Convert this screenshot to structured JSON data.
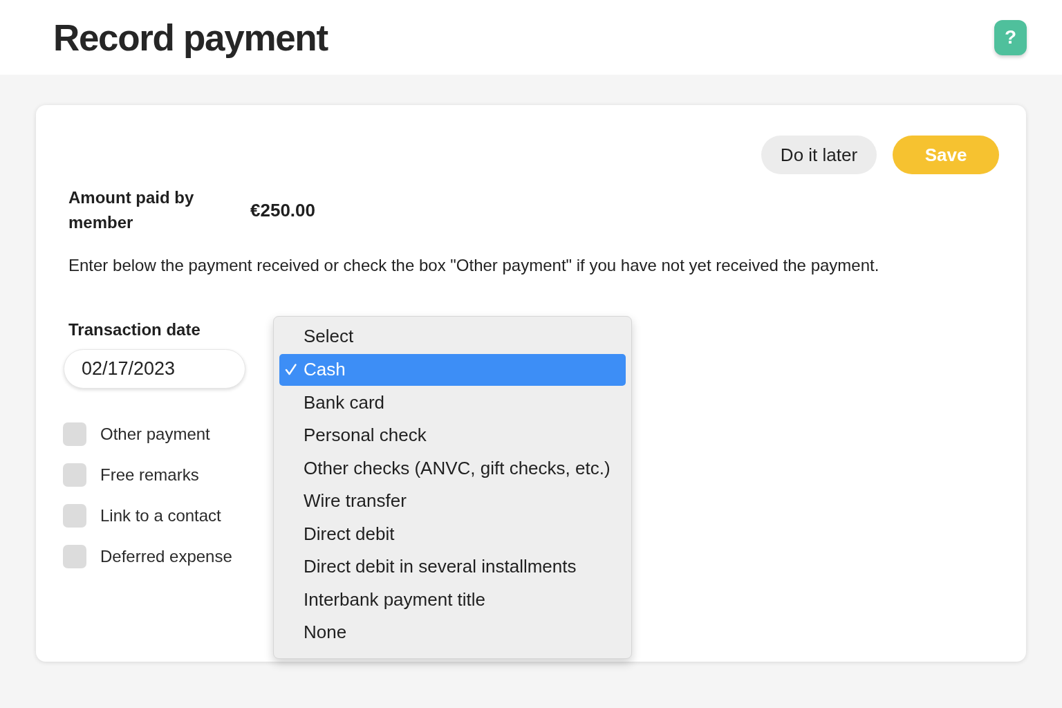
{
  "page": {
    "title": "Record payment",
    "help_button": {
      "label": "?"
    }
  },
  "form": {
    "actions": [
      {
        "label": "Do it later",
        "kind": "secondary"
      },
      {
        "label": "Save",
        "kind": "primary"
      }
    ],
    "amount": {
      "label": "Amount paid by member",
      "value": "€250.00"
    },
    "instructions": "Enter below the payment received or check the box \"Other payment\" if you have not yet received the payment.",
    "transaction_date": {
      "label": "Transaction date",
      "value": "02/17/2023"
    },
    "options": [
      {
        "label": "Other payment",
        "checked": false
      },
      {
        "label": "Free remarks",
        "checked": false
      },
      {
        "label": "Link to a contact",
        "checked": false
      },
      {
        "label": "Deferred expense",
        "checked": false
      }
    ],
    "payment_method_dropdown": {
      "options": [
        {
          "label": "Select",
          "selected": false
        },
        {
          "label": "Cash",
          "selected": true
        },
        {
          "label": "Bank card",
          "selected": false
        },
        {
          "label": "Personal check",
          "selected": false
        },
        {
          "label": "Other checks (ANVC, gift checks, etc.)",
          "selected": false
        },
        {
          "label": "Wire transfer",
          "selected": false
        },
        {
          "label": "Direct debit",
          "selected": false
        },
        {
          "label": "Direct debit in several installments",
          "selected": false
        },
        {
          "label": "Interbank payment title",
          "selected": false
        },
        {
          "label": "None",
          "selected": false
        }
      ]
    }
  }
}
